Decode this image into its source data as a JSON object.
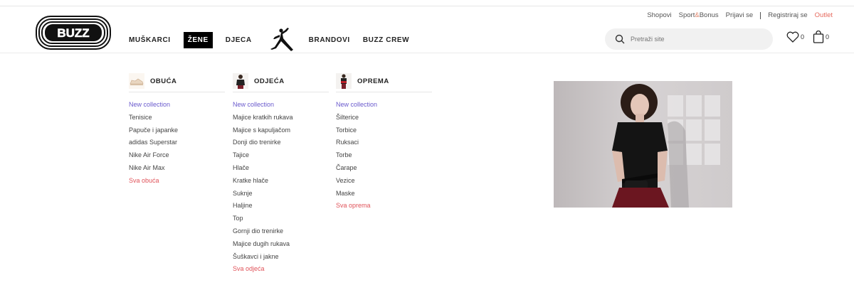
{
  "utility": {
    "shops": "Shopovi",
    "sport": "Sport",
    "amp": "&",
    "bonus": "Bonus",
    "login": "Prijavi se",
    "register": "Registriraj se",
    "outlet": "Outlet"
  },
  "logo_text": "BUZZ",
  "nav": {
    "men": "MUŠKARCI",
    "women": "ŽENE",
    "kids": "DJECA",
    "brands": "BRANDOVI",
    "crew": "BUZZ CREW"
  },
  "search": {
    "placeholder": "Pretraži site"
  },
  "wishlist_count": "0",
  "cart_count": "0",
  "menu": {
    "shoes": {
      "title": "OBUĆA",
      "items": [
        "New collection",
        "Tenisice",
        "Papuče i japanke",
        "adidas Superstar",
        "Nike Air Force",
        "Nike Air Max",
        "Sva obuća"
      ]
    },
    "clothing": {
      "title": "ODJEĆA",
      "items": [
        "New collection",
        "Majice kratkih rukava",
        "Majice s kapuljačom",
        "Donji dio trenirke",
        "Tajice",
        "Hlače",
        "Kratke hlače",
        "Suknje",
        "Haljine",
        "Top",
        "Gornji dio trenirke",
        "Majice dugih rukava",
        "Šuškavci i jakne",
        "Sva odjeća"
      ]
    },
    "gear": {
      "title": "OPREMA",
      "items": [
        "New collection",
        "Šilterice",
        "Torbice",
        "Ruksaci",
        "Torbe",
        "Čarape",
        "Vezice",
        "Maske",
        "Sva oprema"
      ]
    }
  },
  "colors": {
    "new_collection": "#6a5acd",
    "view_all": "#e0535a",
    "outlet": "#e66a5e",
    "active_nav_bg": "#000000"
  }
}
